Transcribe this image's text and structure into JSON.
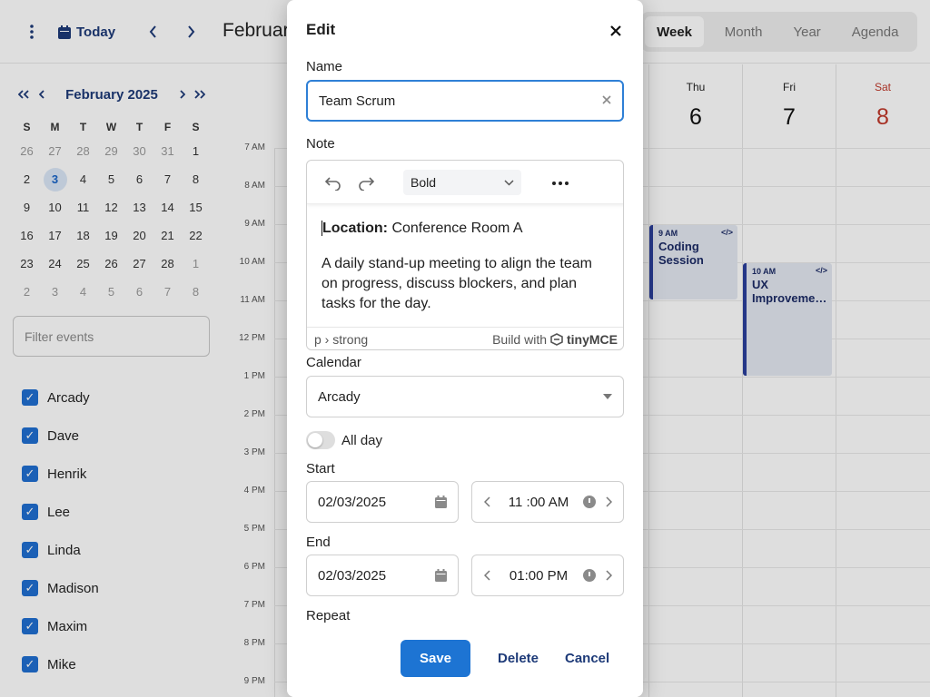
{
  "topbar": {
    "today_label": "Today",
    "title": "February",
    "views": [
      "Week",
      "Month",
      "Year",
      "Agenda"
    ],
    "active_view": "Week"
  },
  "mini_calendar": {
    "title": "February 2025",
    "weekdays": [
      "S",
      "M",
      "T",
      "W",
      "T",
      "F",
      "S"
    ],
    "weeks": [
      [
        "26",
        "27",
        "28",
        "29",
        "30",
        "31",
        "1"
      ],
      [
        "2",
        "3",
        "4",
        "5",
        "6",
        "7",
        "8"
      ],
      [
        "9",
        "10",
        "11",
        "12",
        "13",
        "14",
        "15"
      ],
      [
        "16",
        "17",
        "18",
        "19",
        "20",
        "21",
        "22"
      ],
      [
        "23",
        "24",
        "25",
        "26",
        "27",
        "28",
        "1"
      ],
      [
        "2",
        "3",
        "4",
        "5",
        "6",
        "7",
        "8"
      ]
    ],
    "today": "3"
  },
  "sidebar": {
    "filter_placeholder": "Filter events",
    "calendars": [
      "Arcady",
      "Dave",
      "Henrik",
      "Lee",
      "Linda",
      "Madison",
      "Maxim",
      "Mike"
    ]
  },
  "week_grid": {
    "days": [
      {
        "name": "Thu",
        "num": "6"
      },
      {
        "name": "Fri",
        "num": "7"
      },
      {
        "name": "Sat",
        "num": "8"
      }
    ],
    "hours": [
      "7 AM",
      "8 AM",
      "9 AM",
      "10 AM",
      "11 AM",
      "12 PM",
      "1 PM",
      "2 PM",
      "3 PM",
      "4 PM",
      "5 PM",
      "6 PM",
      "7 PM",
      "8 PM",
      "9 PM"
    ],
    "events": [
      {
        "time": "9 AM",
        "title": "Coding Session",
        "icon": "code-icon"
      },
      {
        "time": "10 AM",
        "title": "UX Improveme…",
        "icon": "code-icon"
      }
    ]
  },
  "dialog": {
    "title": "Edit",
    "name_label": "Name",
    "name_value": "Team Scrum",
    "note_label": "Note",
    "editor": {
      "format_value": "Bold",
      "location_label": "Location:",
      "location_value": " Conference Room A",
      "body": "A daily stand-up meeting to align the team on progress, discuss blockers, and plan tasks for the day.",
      "path": "p › strong",
      "brand_prefix": "Build with",
      "brand_name": "tinyMCE"
    },
    "calendar_label": "Calendar",
    "calendar_value": "Arcady",
    "all_day_label": "All day",
    "all_day": false,
    "start_label": "Start",
    "start_date": "02/03/2025",
    "start_time": "11 :00 AM",
    "end_label": "End",
    "end_date": "02/03/2025",
    "end_time": "01:00 PM",
    "repeat_label": "Repeat",
    "save_label": "Save",
    "delete_label": "Delete",
    "cancel_label": "Cancel"
  },
  "colors": {
    "accent": "#1d74d3",
    "nav_text": "#1d3a78",
    "event_bar": "#2a3f9b",
    "weekend": "#c0392b"
  }
}
